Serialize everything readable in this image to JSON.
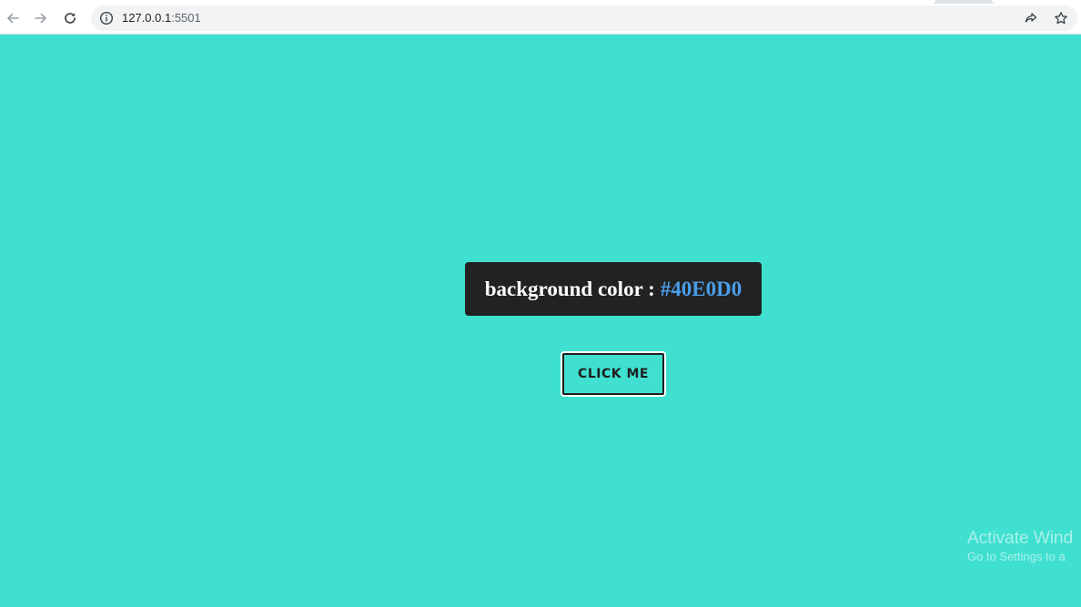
{
  "browser": {
    "url_host": "127.0.0.1",
    "url_port": ":5501",
    "icons": {
      "back": "arrow-left-icon",
      "forward": "arrow-right-icon",
      "reload": "reload-icon",
      "site_info": "info-icon",
      "share": "share-icon",
      "bookmark": "star-icon"
    }
  },
  "page": {
    "background_color": "#40E0D0",
    "color_label_prefix": "background color :",
    "color_label_value": "#40E0D0",
    "button_label": "CLICK ME"
  },
  "watermark": {
    "title": "Activate Wind",
    "subtitle": "Go to Settings to a"
  }
}
